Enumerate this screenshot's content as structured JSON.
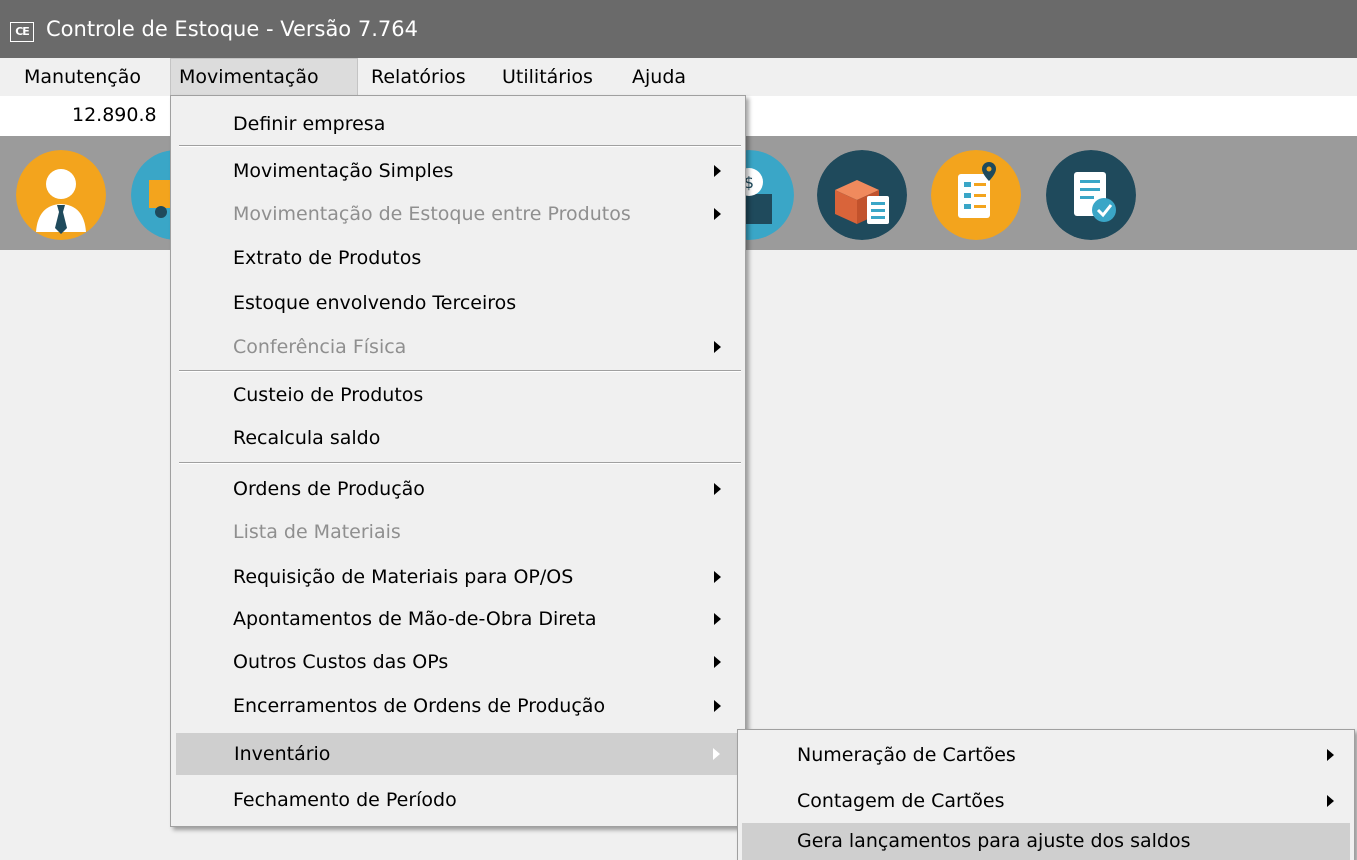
{
  "window": {
    "title": "Controle de Estoque - Versão 7.764",
    "icon_text": "CE"
  },
  "menubar": {
    "items": [
      "Manutenção",
      "Movimentação",
      "Relatórios",
      "Utilitários",
      "Ajuda"
    ],
    "active": "Movimentação"
  },
  "status": {
    "value": "12.890.8"
  },
  "toolbar": {
    "icons": [
      "user-icon",
      "truck-icon",
      "money-box-icon",
      "boxes-clipboard-icon",
      "checklist-location-icon",
      "report-check-icon"
    ],
    "colors": {
      "dark_circle": "#1f4a5c",
      "orange_circle": "#f3a41d",
      "teal_circle": "#3aa6c7"
    }
  },
  "menu": {
    "items": [
      {
        "label": "Definir empresa",
        "disabled": false,
        "submenu": false
      },
      {
        "label": "Movimentação Simples",
        "disabled": false,
        "submenu": true
      },
      {
        "label": "Movimentação de Estoque entre Produtos",
        "disabled": true,
        "submenu": true
      },
      {
        "label": "Extrato de Produtos",
        "disabled": false,
        "submenu": false
      },
      {
        "label": "Estoque envolvendo Terceiros",
        "disabled": false,
        "submenu": false
      },
      {
        "label": "Conferência Física",
        "disabled": true,
        "submenu": true
      },
      {
        "label": "Custeio de Produtos",
        "disabled": false,
        "submenu": false
      },
      {
        "label": "Recalcula saldo",
        "disabled": false,
        "submenu": false
      },
      {
        "label": "Ordens de Produção",
        "disabled": false,
        "submenu": true
      },
      {
        "label": "Lista de Materiais",
        "disabled": true,
        "submenu": false
      },
      {
        "label": "Requisição de Materiais para OP/OS",
        "disabled": false,
        "submenu": true
      },
      {
        "label": "Apontamentos de Mão-de-Obra Direta",
        "disabled": false,
        "submenu": true
      },
      {
        "label": "Outros Custos das OPs",
        "disabled": false,
        "submenu": true
      },
      {
        "label": "Encerramentos de Ordens de Produção",
        "disabled": false,
        "submenu": true
      },
      {
        "label": "Inventário",
        "disabled": false,
        "submenu": true,
        "highlighted": true
      },
      {
        "label": "Fechamento de Período",
        "disabled": false,
        "submenu": false
      }
    ]
  },
  "submenu": {
    "items": [
      {
        "label": "Numeração de  Cartões",
        "submenu": true
      },
      {
        "label": "Contagem de Cartões",
        "submenu": true
      },
      {
        "label": "Gera lançamentos para ajuste dos saldos",
        "submenu": false,
        "highlighted": true
      }
    ]
  }
}
